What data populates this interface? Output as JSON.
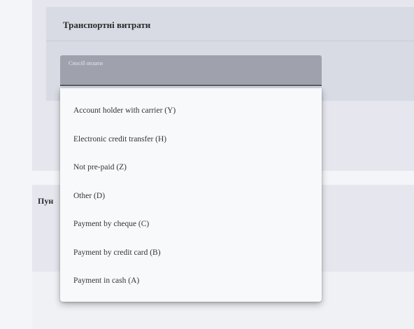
{
  "section": {
    "title": "Транспортні витрати"
  },
  "payment_select": {
    "label": "Спосіб оплати"
  },
  "second_section": {
    "title": "Пункти"
  },
  "dropdown": {
    "options": [
      "Account holder with carrier (Y)",
      "Electronic credit transfer (H)",
      "Not pre-paid (Z)",
      "Other (D)",
      "Payment by cheque (C)",
      "Payment by credit card (B)",
      "Payment in cash (A)"
    ]
  }
}
